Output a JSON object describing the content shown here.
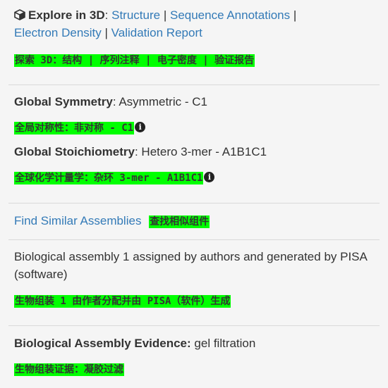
{
  "explore": {
    "label": "Explore in 3D",
    "colon": ":",
    "links": [
      "Structure",
      "Sequence Annotations",
      "Electron Density",
      "Validation Report"
    ],
    "sep": "|",
    "translation": "探索 3D：结构 | 序列注释 | 电子密度 | 验证报告"
  },
  "symmetry": {
    "global_symmetry_label": "Global Symmetry",
    "global_symmetry_value": ": Asymmetric - C1",
    "global_symmetry_translation": "全局对称性：非对称 - C1",
    "stoichiometry_label": "Global Stoichiometry",
    "stoichiometry_value": ": Hetero 3-mer - A1B1C1",
    "stoichiometry_translation": "全球化学计量学：杂环 3-mer - A1B1C1",
    "info_glyph": "i"
  },
  "similar": {
    "link": "Find Similar Assemblies",
    "translation": "查找相似组件"
  },
  "assembly": {
    "line1": "Biological assembly 1 assigned by authors and generated by PISA",
    "line2": "(software)",
    "translation": "生物组装 1 由作者分配并由 PISA（软件）生成"
  },
  "evidence": {
    "label": "Biological Assembly Evidence:",
    "value": " gel filtration",
    "translation": "生物组装证据：凝胶过滤"
  }
}
